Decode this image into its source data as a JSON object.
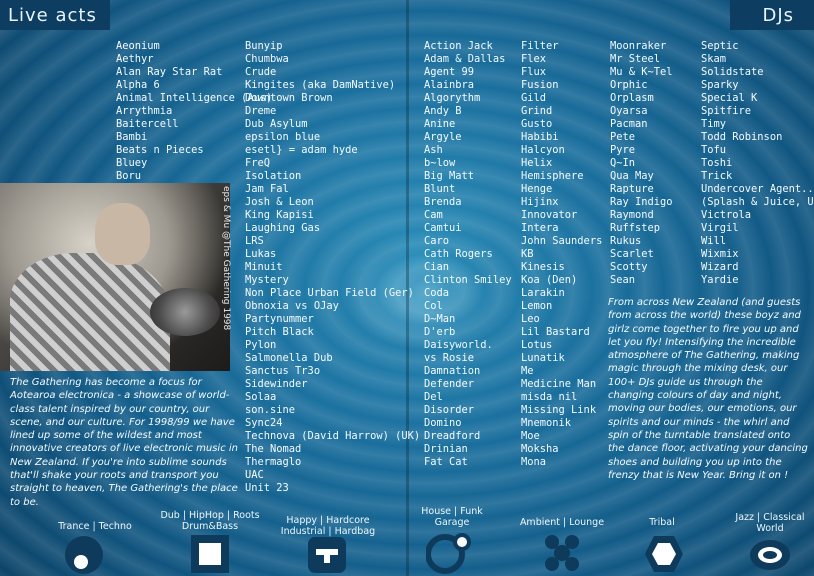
{
  "headers": {
    "left": "Live acts",
    "right": "DJs"
  },
  "live_acts": {
    "column_1": [
      "Aeonium",
      "Aethyr",
      "Alan Ray Star Rat",
      "Alpha 6",
      "Animal Intelligence (Aus)",
      "Arrythmia",
      "Baitercell",
      "Bambi",
      "Beats n Pieces",
      "Bluey",
      "Boru"
    ],
    "column_2": [
      "Bunyip",
      "Chumbwa",
      "Crude",
      "Kingites (aka DamNative)",
      "Downtown Brown",
      "Dreme",
      "Dub Asylum",
      "epsilon blue",
      "esetl} = adam hyde",
      "FreQ",
      "Isolation",
      "Jam Fal",
      "Josh & Leon",
      "King Kapisi",
      "Laughing Gas",
      "LRS",
      "Lukas",
      "Minuit",
      "Mystery",
      "Non Place Urban Field (Ger)",
      "Obnoxia vs OJay",
      "Partynummer",
      "Pitch Black",
      "Pylon",
      "Salmonella Dub",
      "Sanctus Tr3o",
      "Sidewinder",
      "Solaa",
      "son.sine",
      "Sync24",
      "Technova (David Harrow) (UK)",
      "The Nomad",
      "Thermaglo",
      "UAC",
      "Unit 23"
    ]
  },
  "photo_credit": "eps & Mu @The Gathering 1998",
  "live_blurb": "The Gathering has become a focus for Aotearoa electronica - a showcase of world-class talent inspired by our country, our scene, and our culture. For 1998/99 we have lined up some of the wildest and most innovative creators of live electronic music in New Zealand. If you're into sublime sounds that'll shake your roots and transport you straight to heaven, The Gathering's the place to be.",
  "djs": {
    "column_1": [
      "Action Jack",
      "Adam & Dallas",
      "Agent 99",
      "Alainbra",
      "Algorythm",
      "Andy B",
      "Anine",
      "Argyle",
      "Ash",
      "b~low",
      "Big Matt",
      "Blunt",
      "Brenda",
      "Cam",
      "Camtui",
      "Caro",
      "Cath Rogers",
      "Cian",
      "Clinton Smiley",
      "Coda",
      "Col",
      "D~Man",
      "D'erb",
      "Daisyworld.",
      "vs Rosie",
      "Damnation",
      "Defender",
      "Del",
      "Disorder",
      "Domino",
      "Dreadford",
      "Drinian",
      "Fat Cat"
    ],
    "column_2": [
      "Filter",
      "Flex",
      "Flux",
      "Fusion",
      "Gild",
      "Grind",
      "Gusto",
      "Habibi",
      "Halcyon",
      "Helix",
      "Hemisphere",
      "Henge",
      "Hijinx",
      "Innovator",
      "Intera",
      "John Saunders",
      "KB",
      "Kinesis",
      "Koa (Den)",
      "Larakin",
      "Lemon",
      "Leo",
      "Lil Bastard",
      "Lotus",
      "Lunatik",
      "Me",
      "Medicine Man",
      "misda nil",
      "Missing Link",
      "Mnemonik",
      "Moe",
      "Moksha",
      "Mona"
    ],
    "column_3": [
      "Moonraker",
      "Mr Steel",
      "Mu & K~Tel",
      "Orphic",
      "Orplasm",
      "Oyarsa",
      "Pacman",
      "Pete",
      "Pyre",
      "Q~In",
      "Qua May",
      "Rapture",
      "Ray Indigo",
      "Raymond",
      "Ruffstep",
      "Rukus",
      "Scarlet",
      "Scotty",
      "Sean"
    ],
    "column_4": [
      "Septic",
      "Skam",
      "Solidstate",
      "Sparky",
      "Special K",
      "Spitfire",
      "Timy",
      "Todd Robinson",
      "Tofu",
      "Toshi",
      "Trick",
      "Undercover Agent..",
      "(Splash & Juice, UK)",
      "Victrola",
      "Virgil",
      "Will",
      "Wixmix",
      "Wizard",
      "Yardie"
    ]
  },
  "dj_blurb": "From across New Zealand (and guests from across the world) these boyz and girlz come together to fire you up and let you fly! Intensifying the incredible atmosphere of The Gathering, making magic through the mixing desk, our 100+ DJs guide us through the changing colours of day and night, moving our bodies, our emotions, our spirits and our minds - the whirl and spin of the turntable translated onto the dance floor, activating your dancing shoes and building you up into the frenzy that is New Year. Bring it on !",
  "genres": [
    {
      "label": "Trance | Techno",
      "icon": "circle-dot-icon"
    },
    {
      "label": "Dub | HipHop | Roots\nDrum&Bass",
      "icon": "square-frame-icon"
    },
    {
      "label": "Happy | Hardcore\nIndustrial | Hardbag",
      "icon": "rounded-block-icon"
    },
    {
      "label": "House | Funk\nGarage",
      "icon": "double-circle-icon"
    },
    {
      "label": "Ambient | Lounge",
      "icon": "dot-cluster-icon"
    },
    {
      "label": "Tribal",
      "icon": "hexagon-icon"
    },
    {
      "label": "Jazz | Classical\nWorld",
      "icon": "ring-icon"
    }
  ],
  "colors": {
    "header_bar": "#0d3d60",
    "icon_fill": "#0e3a5c",
    "background": "#1a6f9e",
    "text": "#f3fbff"
  }
}
